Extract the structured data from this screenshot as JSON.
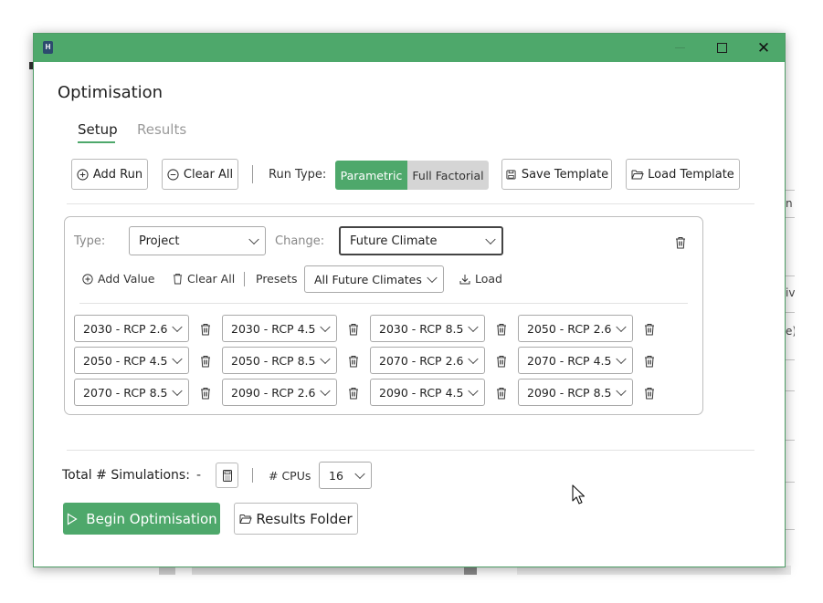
{
  "window": {
    "app_icon": "app-logo-icon",
    "buttons": [
      "minimize-icon",
      "maximize-icon",
      "close-icon"
    ],
    "accent_color": "#4ea86b"
  },
  "dialog": {
    "title": "Optimisation",
    "tabs": [
      {
        "label": "Setup",
        "active": true
      },
      {
        "label": "Results",
        "active": false
      }
    ]
  },
  "toolbar": {
    "add_run": "Add Run",
    "clear_all": "Clear All",
    "run_type_label": "Run Type:",
    "run_type_options": [
      "Parametric",
      "Full Factorial"
    ],
    "run_type_selected": "Parametric",
    "save_template": "Save Template",
    "load_template": "Load Template"
  },
  "run": {
    "type_label": "Type:",
    "type_value": "Project",
    "change_label": "Change:",
    "change_value": "Future Climate",
    "add_value": "Add Value",
    "clear_all": "Clear All",
    "presets_label": "Presets",
    "presets_value": "All Future Climates",
    "load": "Load",
    "values": [
      "2030 - RCP 2.6",
      "2030 - RCP 4.5",
      "2030 - RCP 8.5",
      "2050 - RCP 2.6",
      "2050 - RCP 4.5",
      "2050 - RCP 8.5",
      "2070 - RCP 2.6",
      "2070 - RCP 4.5",
      "2070 - RCP 8.5",
      "2090 - RCP 2.6",
      "2090 - RCP 4.5",
      "2090 - RCP 8.5"
    ]
  },
  "footer": {
    "total_label": "Total # Simulations:",
    "total_value": "-",
    "cpus_label": "# CPUs",
    "cpus_value": "16",
    "begin": "Begin Optimisation",
    "results_folder": "Results Folder"
  },
  "background": {
    "fragments": [
      "n",
      "iv",
      "e)"
    ]
  }
}
